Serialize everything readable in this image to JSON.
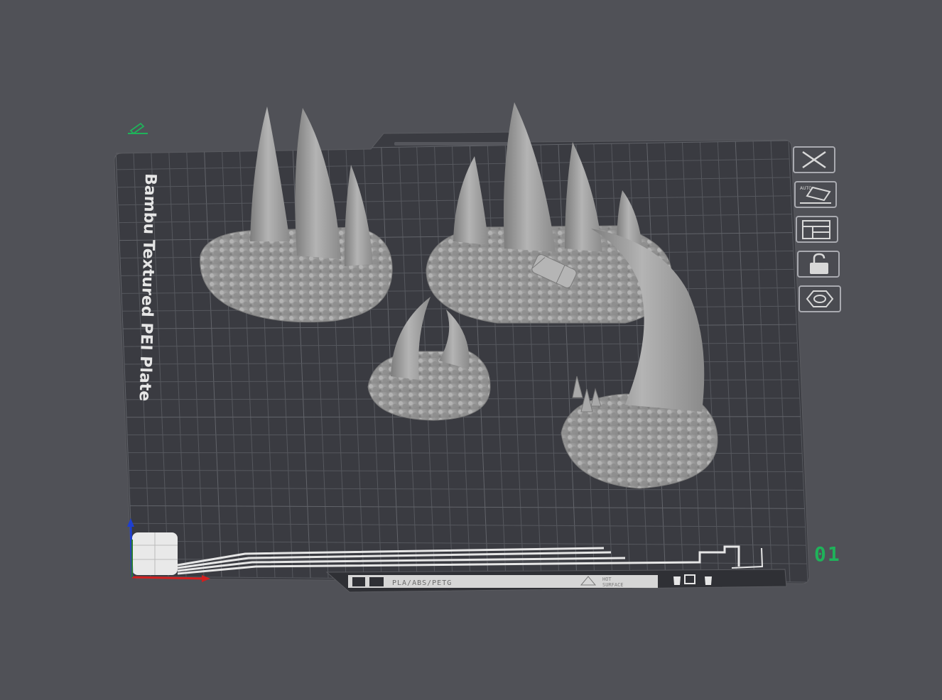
{
  "plate": {
    "label": "Bambu Textured PEI Plate",
    "number": "01",
    "filament_compat": "PLA/ABS/PETG",
    "warning_line1": "HOT",
    "warning_line2": "SURFACE"
  },
  "toolbar": {
    "buttons": [
      {
        "name": "remove-plate-button",
        "icon": "close-icon",
        "label": "",
        "interactable": true
      },
      {
        "name": "auto-orient-button",
        "icon": "auto-orient-icon",
        "label": "AUTO",
        "interactable": true
      },
      {
        "name": "arrange-button",
        "icon": "arrange-layout-icon",
        "label": "",
        "interactable": true
      },
      {
        "name": "lock-plate-button",
        "icon": "unlock-icon",
        "label": "",
        "interactable": true
      },
      {
        "name": "plate-settings-button",
        "icon": "gear-hexagon-icon",
        "label": "",
        "interactable": true
      }
    ]
  },
  "edit_name_icon": "pencil-icon",
  "models": [
    {
      "name": "spike-cluster-three-horns"
    },
    {
      "name": "spike-cluster-large-base"
    },
    {
      "name": "spike-cluster-small-pair"
    },
    {
      "name": "spike-single-large-horn"
    }
  ],
  "colors": {
    "background": "#505157",
    "plate": "#3a3b41",
    "grid": "#54565c",
    "model": "#9c9c9c",
    "accent_green": "#1fb25a",
    "axis_x": "#d21f1f",
    "axis_y": "#2a7a2a",
    "axis_z": "#1e3fd0"
  }
}
